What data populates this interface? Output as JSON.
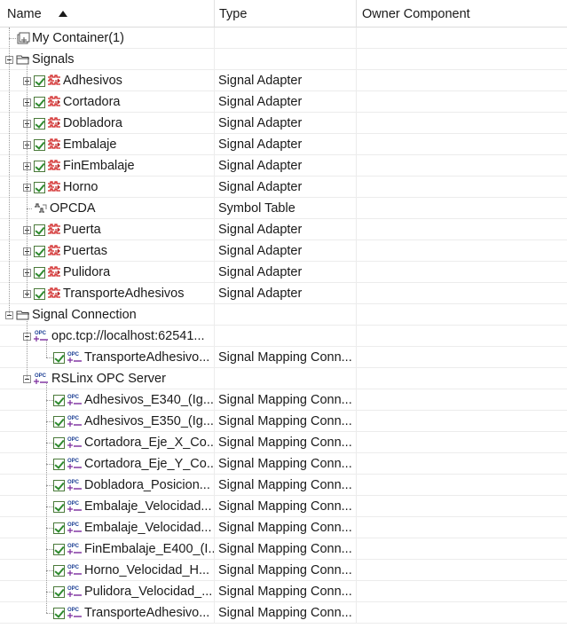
{
  "columns": {
    "name": "Name",
    "type": "Type",
    "owner": "Owner Component"
  },
  "rows": [
    {
      "label": "My Container(1)",
      "type": "",
      "owner": "",
      "level": 0,
      "expander": "none",
      "check": false,
      "icon": "container-icon"
    },
    {
      "label": "Signals",
      "type": "",
      "owner": "",
      "level": 0,
      "expander": "minus",
      "check": false,
      "icon": "folder-icon"
    },
    {
      "label": "Adhesivos",
      "type": "Signal Adapter",
      "owner": "",
      "level": 1,
      "expander": "plus",
      "check": true,
      "icon": "signal-adapter-icon"
    },
    {
      "label": "Cortadora",
      "type": "Signal Adapter",
      "owner": "",
      "level": 1,
      "expander": "plus",
      "check": true,
      "icon": "signal-adapter-icon"
    },
    {
      "label": "Dobladora",
      "type": "Signal Adapter",
      "owner": "",
      "level": 1,
      "expander": "plus",
      "check": true,
      "icon": "signal-adapter-icon"
    },
    {
      "label": "Embalaje",
      "type": "Signal Adapter",
      "owner": "",
      "level": 1,
      "expander": "plus",
      "check": true,
      "icon": "signal-adapter-icon"
    },
    {
      "label": "FinEmbalaje",
      "type": "Signal Adapter",
      "owner": "",
      "level": 1,
      "expander": "plus",
      "check": true,
      "icon": "signal-adapter-icon"
    },
    {
      "label": "Horno",
      "type": "Signal Adapter",
      "owner": "",
      "level": 1,
      "expander": "plus",
      "check": true,
      "icon": "signal-adapter-icon"
    },
    {
      "label": "OPCDA",
      "type": "Symbol Table",
      "owner": "",
      "level": 1,
      "expander": "none",
      "check": false,
      "icon": "symbol-table-icon"
    },
    {
      "label": "Puerta",
      "type": "Signal Adapter",
      "owner": "",
      "level": 1,
      "expander": "plus",
      "check": true,
      "icon": "signal-adapter-icon"
    },
    {
      "label": "Puertas",
      "type": "Signal Adapter",
      "owner": "",
      "level": 1,
      "expander": "plus",
      "check": true,
      "icon": "signal-adapter-icon"
    },
    {
      "label": "Pulidora",
      "type": "Signal Adapter",
      "owner": "",
      "level": 1,
      "expander": "plus",
      "check": true,
      "icon": "signal-adapter-icon"
    },
    {
      "label": "TransporteAdhesivos",
      "type": "Signal Adapter",
      "owner": "",
      "level": 1,
      "expander": "plus",
      "check": true,
      "icon": "signal-adapter-icon"
    },
    {
      "label": "Signal Connection",
      "type": "",
      "owner": "",
      "level": 0,
      "expander": "minus",
      "check": false,
      "icon": "folder-icon"
    },
    {
      "label": "opc.tcp://localhost:62541...",
      "type": "",
      "owner": "",
      "level": 1,
      "expander": "minus",
      "check": false,
      "icon": "opc-server-icon"
    },
    {
      "label": "TransporteAdhesivo...",
      "type": "Signal Mapping Conn...",
      "owner": "",
      "level": 2,
      "expander": "none",
      "check": true,
      "icon": "opc-mapping-icon"
    },
    {
      "label": "RSLinx OPC Server",
      "type": "",
      "owner": "",
      "level": 1,
      "expander": "minus",
      "check": false,
      "icon": "opc-server-icon"
    },
    {
      "label": "Adhesivos_E340_(Ig...",
      "type": "Signal Mapping Conn...",
      "owner": "",
      "level": 2,
      "expander": "none",
      "check": true,
      "icon": "opc-mapping-icon"
    },
    {
      "label": "Adhesivos_E350_(Ig...",
      "type": "Signal Mapping Conn...",
      "owner": "",
      "level": 2,
      "expander": "none",
      "check": true,
      "icon": "opc-mapping-icon"
    },
    {
      "label": "Cortadora_Eje_X_Co...",
      "type": "Signal Mapping Conn...",
      "owner": "",
      "level": 2,
      "expander": "none",
      "check": true,
      "icon": "opc-mapping-icon"
    },
    {
      "label": "Cortadora_Eje_Y_Co...",
      "type": "Signal Mapping Conn...",
      "owner": "",
      "level": 2,
      "expander": "none",
      "check": true,
      "icon": "opc-mapping-icon"
    },
    {
      "label": "Dobladora_Posicion...",
      "type": "Signal Mapping Conn...",
      "owner": "",
      "level": 2,
      "expander": "none",
      "check": true,
      "icon": "opc-mapping-icon"
    },
    {
      "label": "Embalaje_Velocidad...",
      "type": "Signal Mapping Conn...",
      "owner": "",
      "level": 2,
      "expander": "none",
      "check": true,
      "icon": "opc-mapping-icon"
    },
    {
      "label": "Embalaje_Velocidad...",
      "type": "Signal Mapping Conn...",
      "owner": "",
      "level": 2,
      "expander": "none",
      "check": true,
      "icon": "opc-mapping-icon"
    },
    {
      "label": "FinEmbalaje_E400_(I...",
      "type": "Signal Mapping Conn...",
      "owner": "",
      "level": 2,
      "expander": "none",
      "check": true,
      "icon": "opc-mapping-icon"
    },
    {
      "label": "Horno_Velocidad_H...",
      "type": "Signal Mapping Conn...",
      "owner": "",
      "level": 2,
      "expander": "none",
      "check": true,
      "icon": "opc-mapping-icon"
    },
    {
      "label": "Pulidora_Velocidad_...",
      "type": "Signal Mapping Conn...",
      "owner": "",
      "level": 2,
      "expander": "none",
      "check": true,
      "icon": "opc-mapping-icon"
    },
    {
      "label": "TransporteAdhesivo...",
      "type": "Signal Mapping Conn...",
      "owner": "",
      "level": 2,
      "expander": "none",
      "check": true,
      "icon": "opc-mapping-icon"
    }
  ]
}
